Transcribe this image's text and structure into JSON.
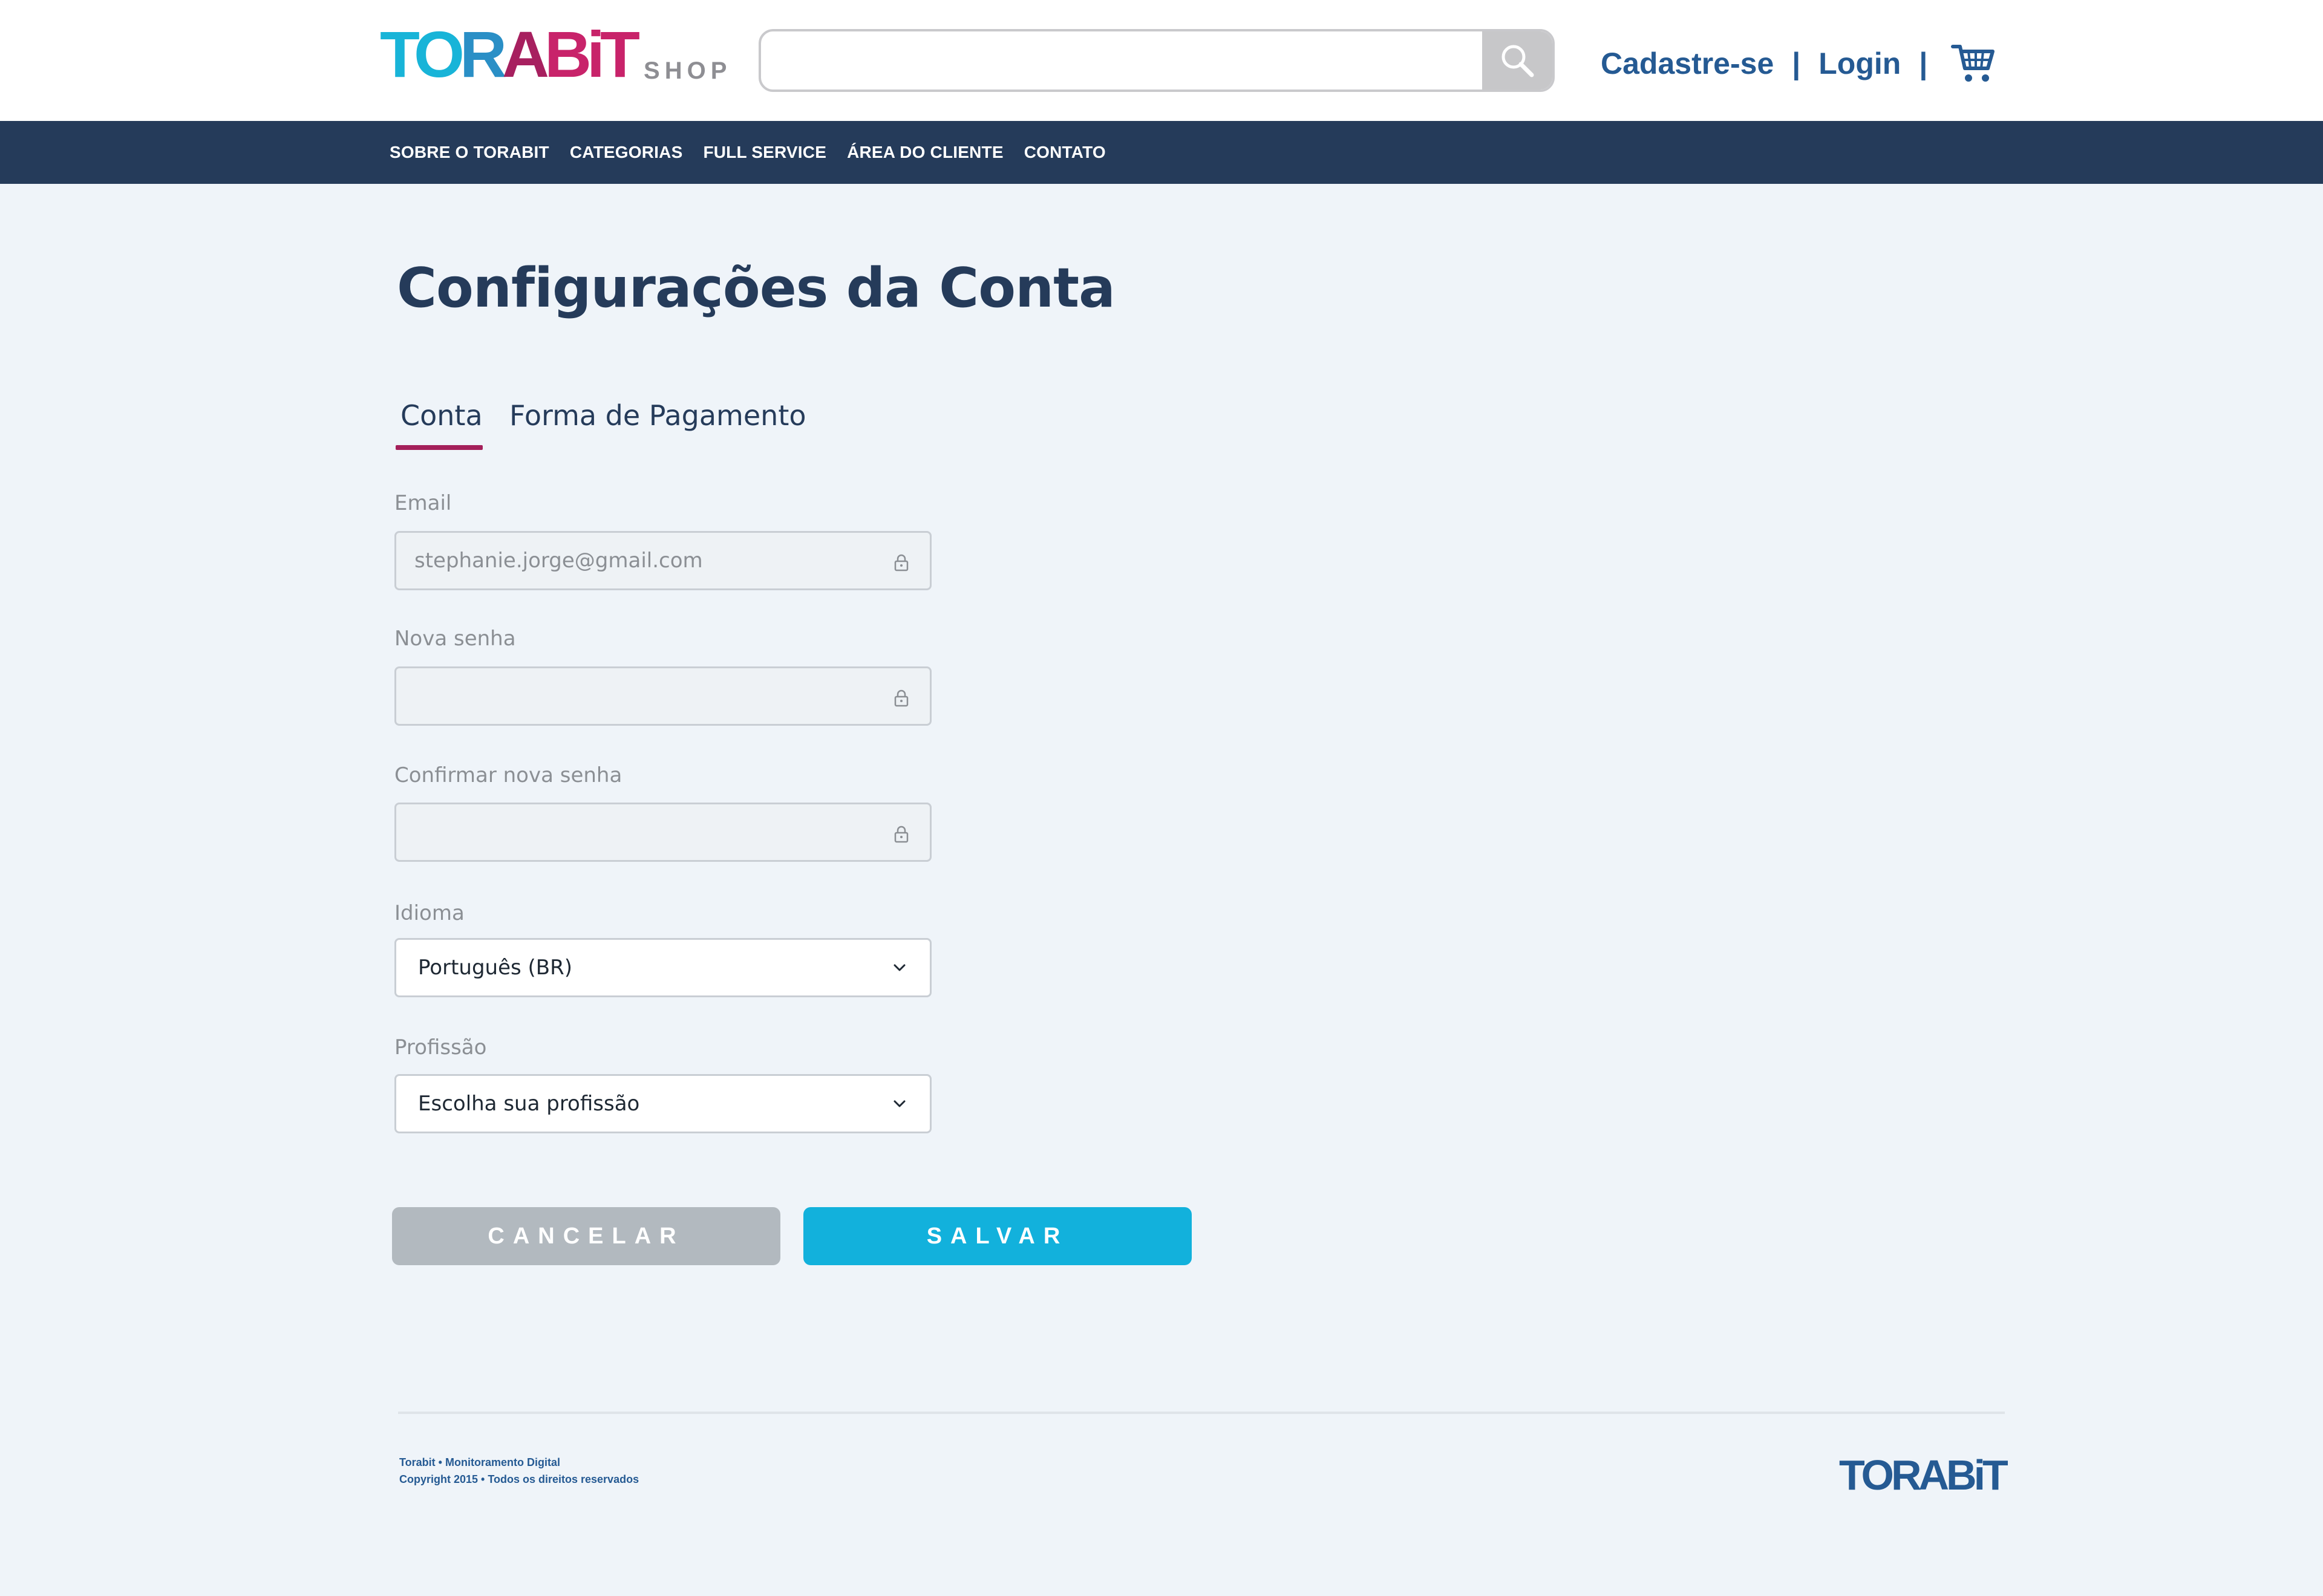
{
  "header": {
    "logo": {
      "text_parts": [
        "TO",
        "R",
        "A",
        "BiT"
      ],
      "shop": "SHOP"
    },
    "search": {
      "value": "",
      "placeholder": ""
    },
    "auth": {
      "signup": "Cadastre-se",
      "separator": "|",
      "login": "Login"
    }
  },
  "nav": {
    "items": [
      "SOBRE O TORABIT",
      "CATEGORIAS",
      "FULL SERVICE",
      "ÁREA DO CLIENTE",
      "CONTATO"
    ]
  },
  "main": {
    "title": "Configurações da Conta",
    "tabs": [
      {
        "label": "Conta",
        "active": true
      },
      {
        "label": "Forma de Pagamento",
        "active": false
      }
    ],
    "fields": {
      "email": {
        "label": "Email",
        "value": "stephanie.jorge@gmail.com"
      },
      "new_password": {
        "label": "Nova senha",
        "value": ""
      },
      "confirm_password": {
        "label": "Confirmar nova senha",
        "value": ""
      },
      "language": {
        "label": "Idioma",
        "value": "Português (BR)"
      },
      "profession": {
        "label": "Profissão",
        "value": "Escolha sua profissão"
      }
    },
    "buttons": {
      "cancel": "CANCELAR",
      "save": "SALVAR"
    }
  },
  "footer": {
    "line1": "Torabit • Monitoramento Digital",
    "line2": "Copyright 2015 • Todos os direitos reservados",
    "logo": "TORABiT"
  },
  "colors": {
    "nav_bg": "#253b5a",
    "accent_link": "#255a93",
    "tab_underline": "#a41f5a",
    "save_button": "#12b1dc",
    "cancel_button": "#b2b9bf",
    "page_bg": "#eff4f9"
  },
  "icons": [
    "search-icon",
    "cart-icon",
    "lock-icon",
    "chevron-down-icon"
  ]
}
